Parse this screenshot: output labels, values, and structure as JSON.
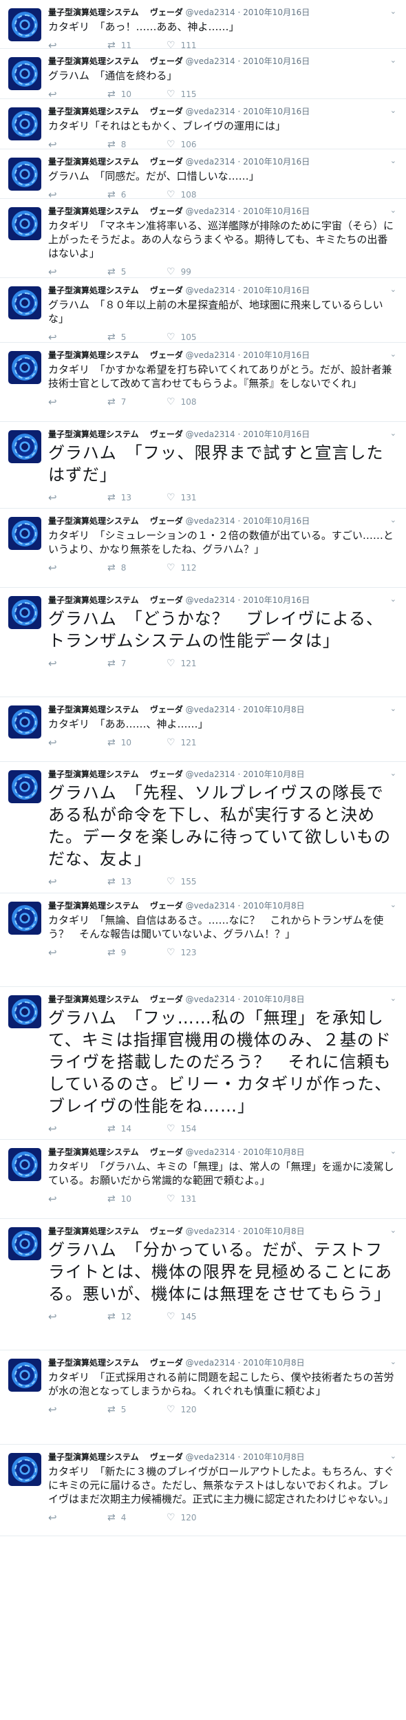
{
  "account": {
    "display_name": "量子型演算処理システム　 ヴェーダ",
    "handle": "@veda2314",
    "separator": "·"
  },
  "icons": {
    "reply": "reply-icon",
    "retweet": "retweet-icon",
    "like": "heart-icon",
    "more": "chevron-down-icon"
  },
  "colors": {
    "name": "#14171a",
    "meta": "#657786",
    "action": "#8899a6",
    "divider": "#e6ecf0"
  },
  "tweets": [
    {
      "date": "2010年10月16日",
      "text": "カタギリ　「あっ！……ああ、神よ……」",
      "size": "s",
      "height": 71,
      "retweets": "11",
      "likes": "111"
    },
    {
      "date": "2010年10月16日",
      "text": "グラハム　「通信を終わる」",
      "size": "s",
      "height": 73,
      "retweets": "10",
      "likes": "115"
    },
    {
      "date": "2010年10月16日",
      "text": "カタギリ「それはともかく、ブレイヴの運用には」",
      "size": "s",
      "height": 73,
      "retweets": "8",
      "likes": "106"
    },
    {
      "date": "2010年10月16日",
      "text": "グラハム　「同感だ。だが、口惜しいな……」",
      "size": "s",
      "height": 72,
      "retweets": "6",
      "likes": "108"
    },
    {
      "date": "2010年10月16日",
      "text": "カタギリ　「マネキン准将率いる、巡洋艦隊が排除のために宇宙（そら）に上がったそうだよ。あの人ならうまくやる。期待しても、キミたちの出番はないよ」",
      "size": "s",
      "height": 115,
      "retweets": "5",
      "likes": "99"
    },
    {
      "date": "2010年10月16日",
      "text": "グラハム　「８０年以上前の木星探査船が、地球圏に飛来しているらしいな」",
      "size": "s",
      "height": 94,
      "retweets": "5",
      "likes": "105"
    },
    {
      "date": "2010年10月16日",
      "text": "カタギリ　「かすかな希望を打ち砕いてくれてありがとう。だが、設計者兼技術士官として改めて言わせてもらうよ。『無茶』をしないでくれ」",
      "size": "s",
      "height": 115,
      "retweets": "7",
      "likes": "108"
    },
    {
      "date": "2010年10月16日",
      "text": "グラハム　「フッ、限界まで試すと宣言したはずだ」",
      "size": "l",
      "height": 126,
      "retweets": "13",
      "likes": "131"
    },
    {
      "date": "2010年10月16日",
      "text": "カタギリ　「シミュレーションの１・２倍の数値が出ている。すごい……というより、かなり無茶をしたね、グラハム？」",
      "size": "s",
      "height": 115,
      "retweets": "8",
      "likes": "112"
    },
    {
      "date": "2010年10月16日",
      "text": "グラハム　「どうかな？　ブレイヴによる、トランザムシステムの性能データは」",
      "size": "l",
      "height": 159,
      "retweets": "7",
      "likes": "121"
    },
    {
      "date": "2010年10月8日",
      "text": "カタギリ　「ああ……、神よ……」",
      "size": "s",
      "height": 94,
      "retweets": "10",
      "likes": "121"
    },
    {
      "date": "2010年10月8日",
      "text": "グラハム　「先程、ソルブレイヴスの隊長である私が命令を下し、私が実行すると決めた。データを楽しみに待っていて欲しいものだな、友よ」",
      "size": "l",
      "height": 191,
      "retweets": "13",
      "likes": "155"
    },
    {
      "date": "2010年10月8日",
      "text": "カタギリ　「無論、自信はあるさ。……なに？　これからトランザムを使う？　そんな報告は聞いていないよ、グラハム！？」",
      "size": "s",
      "height": 136,
      "retweets": "9",
      "likes": "123"
    },
    {
      "date": "2010年10月8日",
      "text": "グラハム　「フッ……私の「無理」を承知して、キミは指揮官機用の機体のみ、２基のドライヴを搭載したのだろう？　それに信頼もしているのさ。ビリー・カタギリが作った、ブレイヴの性能をね……」",
      "size": "l",
      "height": 222,
      "retweets": "14",
      "likes": "154"
    },
    {
      "date": "2010年10月8日",
      "text": "カタギリ　「グラハム、キミの「無理」は、常人の「無理」を遥かに凌駕している。お願いだから常識的な範囲で頼むよ。」",
      "size": "s",
      "height": 115,
      "retweets": "10",
      "likes": "131"
    },
    {
      "date": "2010年10月8日",
      "text": "グラハム　「分かっている。だが、テストフライトとは、機体の限界を見極めることにある。悪いが、機体には無理をさせてもらう」",
      "size": "l",
      "height": 191,
      "retweets": "12",
      "likes": "145"
    },
    {
      "date": "2010年10月8日",
      "text": "カタギリ　「正式採用される前に問題を起こしたら、僕や技術者たちの苦労が水の泡となってしまうからね。くれぐれも慎重に頼むよ」",
      "size": "s",
      "height": 137,
      "retweets": "5",
      "likes": "120"
    },
    {
      "date": "2010年10月8日",
      "text": "カタギリ　「新たに３機のブレイヴがロールアウトしたよ。もちろん、すぐにキミの元に届けるさ。ただし、無茶なテストはしないでおくれよ。ブレイヴはまだ次期主力候補機だ。正式に主力機に認定されたわけじゃない。」",
      "size": "s",
      "height": 133,
      "retweets": "4",
      "likes": "120"
    }
  ]
}
